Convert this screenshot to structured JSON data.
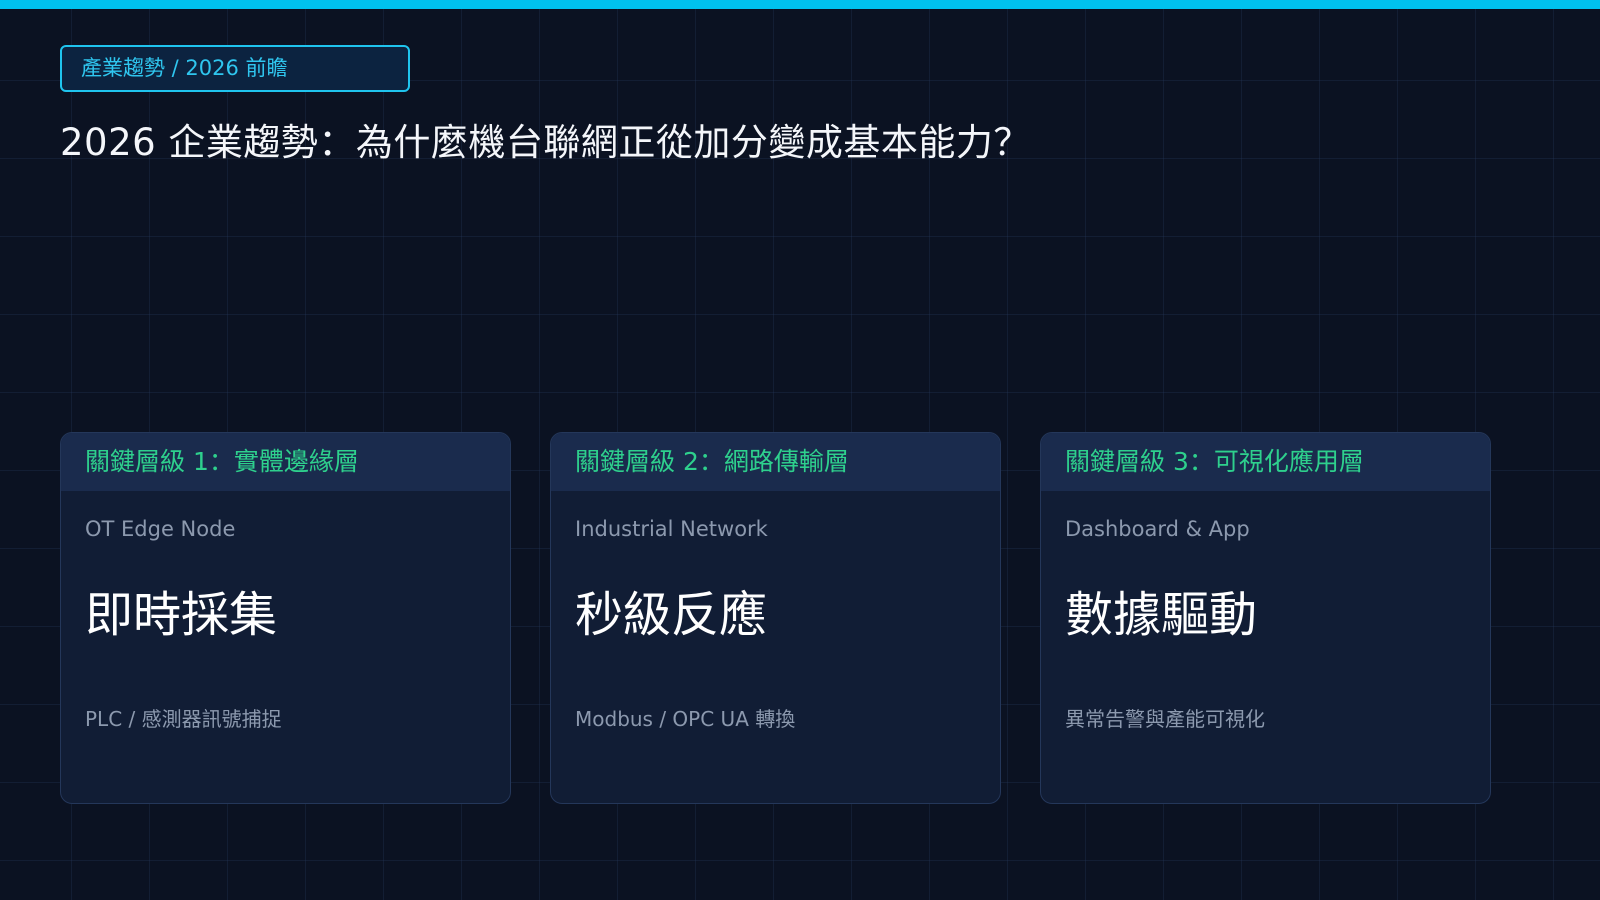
{
  "colors": {
    "background": "#0b1222",
    "accent_bar": "#00c2ee",
    "tag_text": "#2fc6ef",
    "card_background": "#111d35",
    "card_header_background": "#1a2b4d",
    "card_header_text": "#2ed08d",
    "muted_text": "#8c99ae",
    "headline_text": "#ffffff"
  },
  "header": {
    "tag": "產業趨勢 / 2026 前瞻",
    "title": "2026 企業趨勢：為什麼機台聯網正從加分變成基本能力？"
  },
  "cards": [
    {
      "header": "關鍵層級 1：實體邊緣層",
      "subtitle": "OT Edge Node",
      "headline": "即時採集",
      "description": "PLC / 感測器訊號捕捉"
    },
    {
      "header": "關鍵層級 2：網路傳輸層",
      "subtitle": "Industrial Network",
      "headline": "秒級反應",
      "description": "Modbus / OPC UA 轉換"
    },
    {
      "header": "關鍵層級 3：可視化應用層",
      "subtitle": "Dashboard & App",
      "headline": "數據驅動",
      "description": "異常告警與產能可視化"
    }
  ]
}
